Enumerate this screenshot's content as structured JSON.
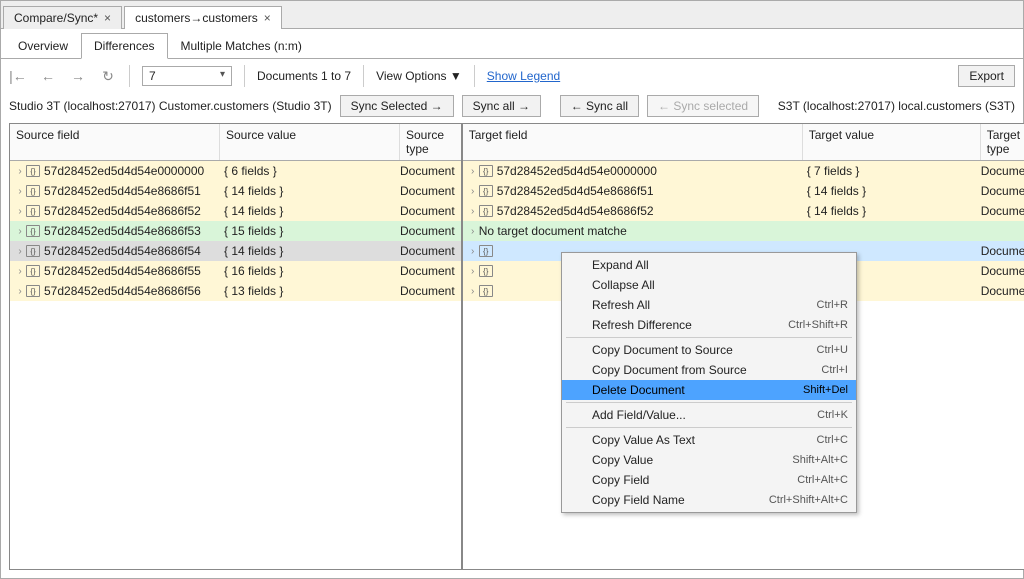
{
  "topTabs": [
    {
      "label": "Compare/Sync*",
      "active": false
    },
    {
      "label": "customers→customers",
      "active": true
    }
  ],
  "subTabs": [
    {
      "label": "Overview",
      "active": false
    },
    {
      "label": "Differences",
      "active": true
    },
    {
      "label": "Multiple Matches (n:m)",
      "active": false
    }
  ],
  "nav": {
    "page": "7",
    "range": "Documents 1 to 7",
    "viewOptions": "View Options ▼",
    "legend": "Show Legend",
    "export": "Export"
  },
  "source": {
    "title": "Studio 3T (localhost:27017) Customer.customers (Studio 3T)",
    "syncSelected": "Sync Selected →",
    "syncAll": "Sync all →",
    "cols": {
      "field": "Source field",
      "value": "Source value",
      "type": "Source type"
    },
    "rows": [
      {
        "id": "57d28452ed5d4d54e0000000",
        "v": "{ 6 fields }",
        "t": "Document",
        "cls": "yellow"
      },
      {
        "id": "57d28452ed5d4d54e8686f51",
        "v": "{ 14 fields }",
        "t": "Document",
        "cls": "yellow"
      },
      {
        "id": "57d28452ed5d4d54e8686f52",
        "v": "{ 14 fields }",
        "t": "Document",
        "cls": "yellow"
      },
      {
        "id": "57d28452ed5d4d54e8686f53",
        "v": "{ 15 fields }",
        "t": "Document",
        "cls": "green"
      },
      {
        "id": "57d28452ed5d4d54e8686f54",
        "v": "{ 14 fields }",
        "t": "Document",
        "cls": "sel"
      },
      {
        "id": "57d28452ed5d4d54e8686f55",
        "v": "{ 16 fields }",
        "t": "Document",
        "cls": "yellow"
      },
      {
        "id": "57d28452ed5d4d54e8686f56",
        "v": "{ 13 fields }",
        "t": "Document",
        "cls": "yellow"
      }
    ]
  },
  "target": {
    "title": "S3T (localhost:27017) local.customers (S3T)",
    "syncSelected": "← Sync selected",
    "syncAll": "← Sync all",
    "cols": {
      "field": "Target field",
      "value": "Target value",
      "type": "Target type"
    },
    "rows": [
      {
        "id": "57d28452ed5d4d54e0000000",
        "v": "{ 7 fields }",
        "t": "Document",
        "cls": "yellow",
        "icon": true
      },
      {
        "id": "57d28452ed5d4d54e8686f51",
        "v": "{ 14 fields }",
        "t": "Document",
        "cls": "yellow",
        "icon": true
      },
      {
        "id": "57d28452ed5d4d54e8686f52",
        "v": "{ 14 fields }",
        "t": "Document",
        "cls": "yellow",
        "icon": true
      },
      {
        "id": "No target document matche",
        "v": "",
        "t": "",
        "cls": "green",
        "icon": false
      },
      {
        "id": "",
        "v": "",
        "t": "Document",
        "cls": "blue",
        "icon": true
      },
      {
        "id": "",
        "v": "",
        "t": "Document",
        "cls": "yellow",
        "icon": true
      },
      {
        "id": "",
        "v": "",
        "t": "Document",
        "cls": "yellow",
        "icon": true
      }
    ]
  },
  "ctxMenu": [
    {
      "label": "Expand All",
      "sc": "",
      "sep": false
    },
    {
      "label": "Collapse All",
      "sc": "",
      "sep": false
    },
    {
      "label": "Refresh All",
      "sc": "Ctrl+R",
      "sep": false
    },
    {
      "label": "Refresh Difference",
      "sc": "Ctrl+Shift+R",
      "sep": false
    },
    {
      "sep": true
    },
    {
      "label": "Copy Document to Source",
      "sc": "Ctrl+U",
      "sep": false
    },
    {
      "label": "Copy Document from Source",
      "sc": "Ctrl+I",
      "sep": false
    },
    {
      "label": "Delete Document",
      "sc": "Shift+Del",
      "hl": true,
      "sep": false
    },
    {
      "sep": true
    },
    {
      "label": "Add Field/Value...",
      "sc": "Ctrl+K",
      "sep": false
    },
    {
      "sep": true
    },
    {
      "label": "Copy Value As Text",
      "sc": "Ctrl+C",
      "sep": false
    },
    {
      "label": "Copy Value",
      "sc": "Shift+Alt+C",
      "sep": false
    },
    {
      "label": "Copy Field",
      "sc": "Ctrl+Alt+C",
      "sep": false
    },
    {
      "label": "Copy Field Name",
      "sc": "Ctrl+Shift+Alt+C",
      "sep": false
    }
  ]
}
